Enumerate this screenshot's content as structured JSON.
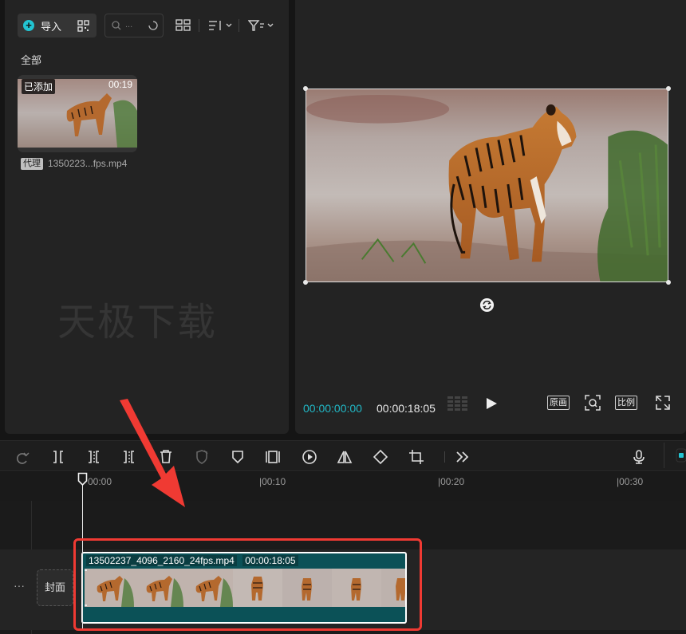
{
  "media": {
    "import_label": "导入",
    "search_placeholder": "...",
    "section_title": "全部",
    "clip": {
      "added_badge": "已添加",
      "duration": "00:19",
      "proxy_badge": "代理",
      "name": "1350223...fps.mp4"
    },
    "watermark": "天极下载"
  },
  "preview": {
    "current_time": "00:00:00:00",
    "total_time": "00:00:18:05",
    "original_btn": "原画",
    "ratio_btn": "比例"
  },
  "timeline": {
    "ruler_labels": [
      "00:00",
      "|00:10",
      "|00:20",
      "|00:30"
    ],
    "cover_label": "封面",
    "more_label": "···",
    "clip_name": "13502237_4096_2160_24fps.mp4",
    "clip_duration": "00:00:18:05"
  },
  "colors": {
    "accent": "#21b8c6",
    "clip_fill": "#0b5157",
    "highlight": "#f03a33"
  },
  "icons": [
    "plus-icon",
    "qr-icon",
    "search-icon",
    "layout-icon",
    "sort-icon",
    "filter-icon",
    "rotate-icon",
    "play-icon",
    "zoom-fit-icon",
    "fullscreen-icon",
    "redo-icon",
    "split-icon",
    "split-left-icon",
    "split-right-icon",
    "delete-icon",
    "shield-icon",
    "marker-icon",
    "freeze-icon",
    "speed-icon",
    "mirror-icon",
    "rotate-clip-icon",
    "crop-icon",
    "more-icon",
    "mic-icon"
  ]
}
